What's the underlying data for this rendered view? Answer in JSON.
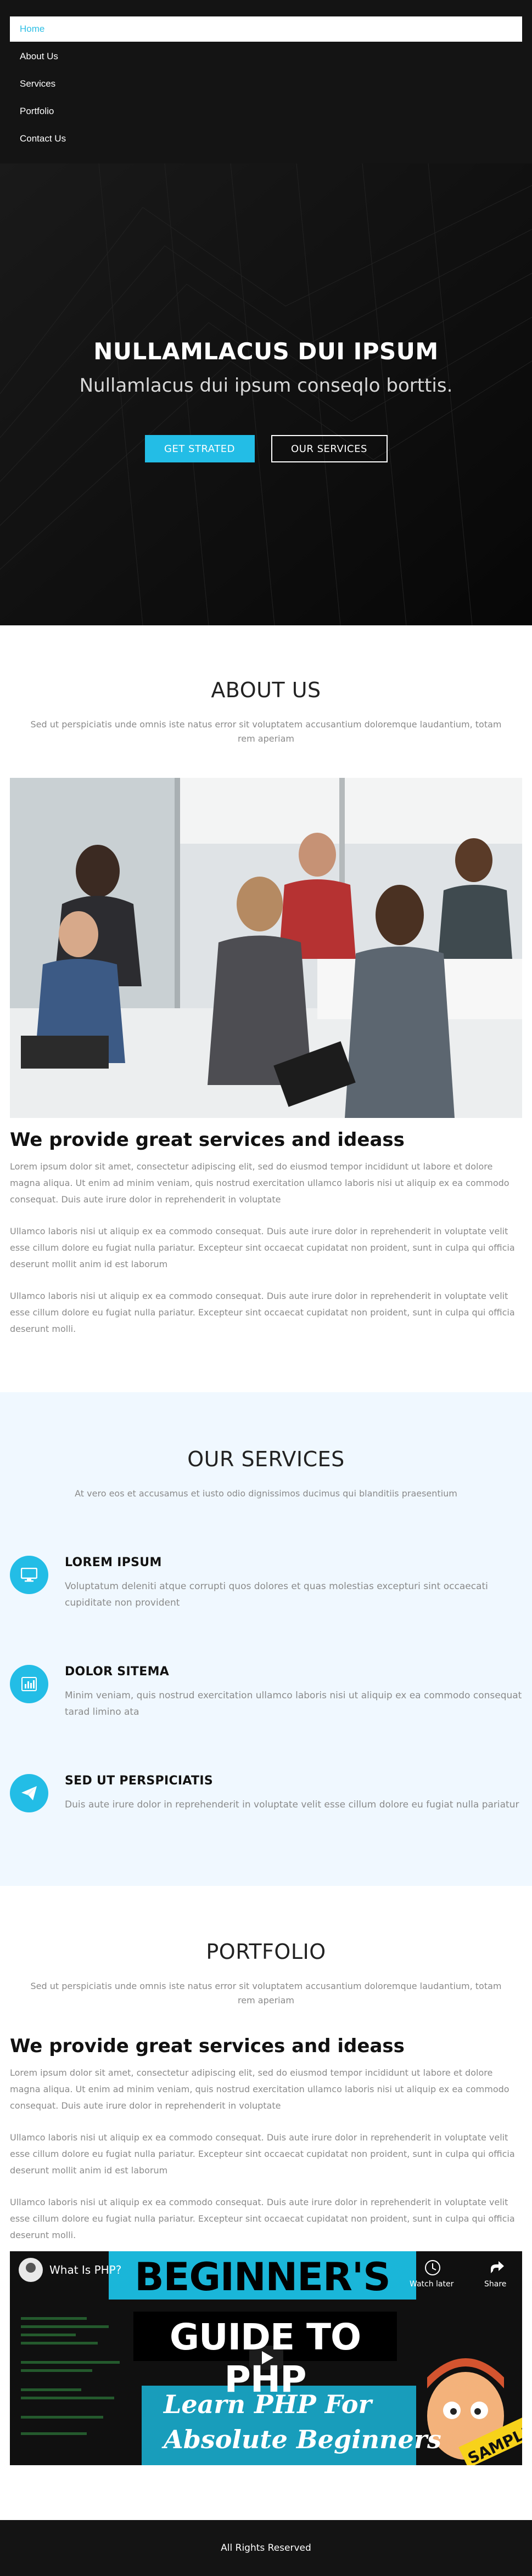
{
  "nav": {
    "items": [
      {
        "label": "Home",
        "active": true
      },
      {
        "label": "About Us",
        "active": false
      },
      {
        "label": "Services",
        "active": false
      },
      {
        "label": "Portfolio",
        "active": false
      },
      {
        "label": "Contact Us",
        "active": false
      }
    ]
  },
  "hero": {
    "title": "NULLAMLACUS DUI IPSUM",
    "subtitle": "Nullamlacus dui ipsum conseqlo borttis.",
    "primary_button": "GET STRATED",
    "secondary_button": "OUR SERVICES"
  },
  "about": {
    "title": "ABOUT US",
    "description": "Sed ut perspiciatis unde omnis iste natus error sit voluptatem accusantium doloremque laudantium, totam rem aperiam",
    "heading": "We provide great services and ideass",
    "paragraphs": [
      "Lorem ipsum dolor sit amet, consectetur adipiscing elit, sed do eiusmod tempor incididunt ut labore et dolore magna aliqua. Ut enim ad minim veniam, quis nostrud exercitation ullamco laboris nisi ut aliquip ex ea commodo consequat. Duis aute irure dolor in reprehenderit in voluptate",
      "Ullamco laboris nisi ut aliquip ex ea commodo consequat. Duis aute irure dolor in reprehenderit in voluptate velit esse cillum dolore eu fugiat nulla pariatur. Excepteur sint occaecat cupidatat non proident, sunt in culpa qui officia deserunt mollit anim id est laborum",
      "Ullamco laboris nisi ut aliquip ex ea commodo consequat. Duis aute irure dolor in reprehenderit in voluptate velit esse cillum dolore eu fugiat nulla pariatur. Excepteur sint occaecat cupidatat non proident, sunt in culpa qui officia deserunt molli."
    ]
  },
  "services": {
    "title": "OUR SERVICES",
    "description": "At vero eos et accusamus et iusto odio dignissimos ducimus qui blanditiis praesentium",
    "items": [
      {
        "icon": "monitor-icon",
        "title": "LOREM IPSUM",
        "text": "Voluptatum deleniti atque corrupti quos dolores et quas molestias excepturi sint occaecati cupiditate non provident"
      },
      {
        "icon": "bar-chart-icon",
        "title": "DOLOR SITEMA",
        "text": "Minim veniam, quis nostrud exercitation ullamco laboris nisi ut aliquip ex ea commodo consequat tarad limino ata"
      },
      {
        "icon": "paper-plane-icon",
        "title": "SED UT PERSPICIATIS",
        "text": "Duis aute irure dolor in reprehenderit in voluptate velit esse cillum dolore eu fugiat nulla pariatur"
      }
    ]
  },
  "portfolio": {
    "title": "PORTFOLIO",
    "description": "Sed ut perspiciatis unde omnis iste natus error sit voluptatem accusantium doloremque laudantium, totam rem aperiam",
    "heading": "We provide great services and ideass",
    "paragraphs": [
      "Lorem ipsum dolor sit amet, consectetur adipiscing elit, sed do eiusmod tempor incididunt ut labore et dolore magna aliqua. Ut enim ad minim veniam, quis nostrud exercitation ullamco laboris nisi ut aliquip ex ea commodo consequat. Duis aute irure dolor in reprehenderit in voluptate",
      "Ullamco laboris nisi ut aliquip ex ea commodo consequat. Duis aute irure dolor in reprehenderit in voluptate velit esse cillum dolore eu fugiat nulla pariatur. Excepteur sint occaecat cupidatat non proident, sunt in culpa qui officia deserunt mollit anim id est laborum",
      "Ullamco laboris nisi ut aliquip ex ea commodo consequat. Duis aute irure dolor in reprehenderit in voluptate velit esse cillum dolore eu fugiat nulla pariatur. Excepteur sint occaecat cupidatat non proident, sunt in culpa qui officia deserunt molli."
    ],
    "video": {
      "title": "What Is PHP?",
      "watch_later": "Watch later",
      "share": "Share",
      "headline_1": "BEGINNER'S",
      "headline_2": "GUIDE TO PHP",
      "tagline_1": "Learn PHP For",
      "tagline_2": "Absolute Beginners",
      "ribbon": "SAMPLE"
    }
  },
  "footer": {
    "text": "All Rights Reserved"
  },
  "colors": {
    "accent": "#23bde6",
    "nav_bg": "#141414",
    "services_bg": "#f0f8ff"
  }
}
